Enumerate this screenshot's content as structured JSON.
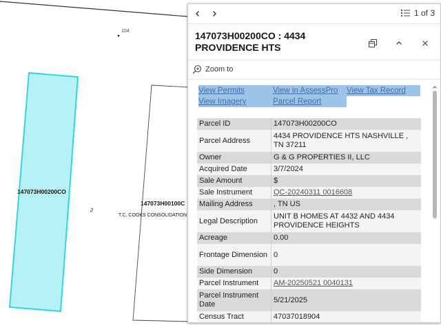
{
  "map": {
    "lot_number": "104",
    "block_number": "2",
    "selected_parcel_label": "147073H00200CO",
    "neighbor_parcel_label": "147073H00100C",
    "consolidation_label": "T.C. COOKS CONSOLIDATION",
    "selected_fill": "#b6f1f6",
    "selected_stroke": "#2fd6e0"
  },
  "popup": {
    "pager": {
      "prev_icon": "chevron-left-icon",
      "next_icon": "chevron-right-icon",
      "list_icon": "list-icon",
      "text": "1 of 3"
    },
    "title": "147073H00200CO : 4434 PROVIDENCE HTS",
    "header_buttons": {
      "dock_icon": "dock-icon",
      "collapse_icon": "chevron-up-icon",
      "close_icon": "close-icon"
    },
    "zoom_to": "Zoom to",
    "links": [
      "View Permits",
      "View in AssessPro",
      "View Tax Record",
      "View Imagery",
      "Parcel Report"
    ],
    "attributes": [
      {
        "key": "Parcel ID",
        "value": "147073H00200CO",
        "link": false
      },
      {
        "key": "Parcel Address",
        "value": "4434 PROVIDENCE HTS NASHVILLE , TN 37211",
        "link": false
      },
      {
        "key": "Owner",
        "value": "G & G PROPERTIES II, LLC",
        "link": false
      },
      {
        "key": "Acquired Date",
        "value": "3/7/2024",
        "link": false
      },
      {
        "key": "Sale Amount",
        "value": "$",
        "link": false
      },
      {
        "key": "Sale Instrument",
        "value": "QC-20240311 0016608",
        "link": true
      },
      {
        "key": "Mailing Address",
        "value": "   , TN   US",
        "link": false
      },
      {
        "key": "Legal Description",
        "value": "UNIT B HOMES AT 4432 AND 4434 PROVIDENCE HEIGHTS",
        "link": false
      },
      {
        "key": "Acreage",
        "value": "0.00",
        "link": false
      },
      {
        "key": "Frontage Dimension",
        "value": "0",
        "link": false
      },
      {
        "key": "Side Dimension",
        "value": "0",
        "link": false
      },
      {
        "key": "Parcel Instrument",
        "value": "AM-20250521 0040131",
        "link": true
      },
      {
        "key": "Parcel Instrument Date",
        "value": "5/21/2025",
        "link": false
      },
      {
        "key": "Census Tract",
        "value": "47037018904",
        "link": false
      }
    ]
  }
}
